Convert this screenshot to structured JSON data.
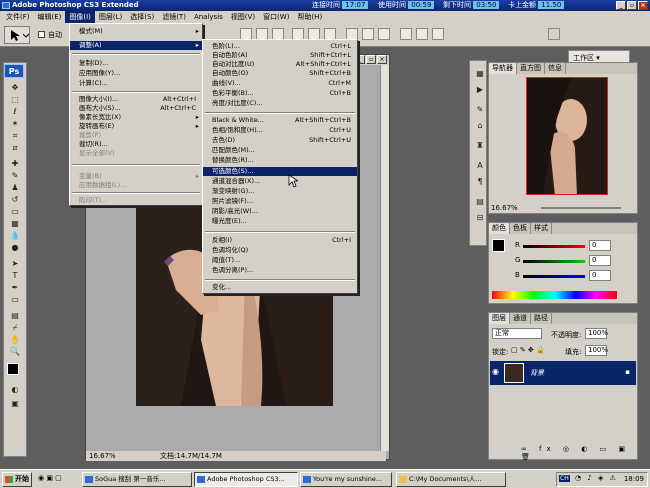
{
  "titlebar": {
    "title": "Adobe Photoshop CS3 Extended",
    "stats": [
      {
        "label": "连接时间",
        "value": "17:07"
      },
      {
        "label": "使用时间",
        "value": "00:59"
      },
      {
        "label": "剩下时间",
        "value": "03:50"
      },
      {
        "label": "卡上金额",
        "value": "11.50"
      }
    ]
  },
  "menubar": [
    "文件(F)",
    "编辑(E)",
    "图像(I)",
    "图层(L)",
    "选择(S)",
    "滤镜(T)",
    "Analysis",
    "视图(V)",
    "窗口(W)",
    "帮助(H)"
  ],
  "options": {
    "check_label": "自动",
    "workspace": "工作区"
  },
  "image_menu": [
    {
      "label": "模式(M)",
      "arrow": "▸"
    },
    {
      "label": "调整(A)",
      "arrow": "▸",
      "highlight": true
    },
    {
      "label": "复制(D)..."
    },
    {
      "label": "应用图像(Y)..."
    },
    {
      "label": "计算(C)..."
    },
    {
      "label": "图像大小(I)...",
      "shortcut": "Alt+Ctrl+I"
    },
    {
      "label": "画布大小(S)...",
      "shortcut": "Alt+Ctrl+C"
    },
    {
      "label": "像素长宽比(X)",
      "arrow": "▸"
    },
    {
      "label": "旋转画布(E)",
      "arrow": "▸"
    },
    {
      "label": "裁剪(P)",
      "disabled": true
    },
    {
      "label": "裁切(R)..."
    },
    {
      "label": "显示全部(V)",
      "disabled": true
    },
    {
      "label": "变量(B)",
      "arrow": "▸",
      "disabled": true
    },
    {
      "label": "应用数据组(L)...",
      "disabled": true
    },
    {
      "label": "陷印(T)...",
      "disabled": true
    }
  ],
  "adjust_menu": [
    {
      "label": "色阶(L)...",
      "shortcut": "Ctrl+L"
    },
    {
      "label": "自动色阶(A)",
      "shortcut": "Shift+Ctrl+L"
    },
    {
      "label": "自动对比度(U)",
      "shortcut": "Alt+Shift+Ctrl+L"
    },
    {
      "label": "自动颜色(O)",
      "shortcut": "Shift+Ctrl+B"
    },
    {
      "label": "曲线(V)...",
      "shortcut": "Ctrl+M"
    },
    {
      "label": "色彩平衡(B)...",
      "shortcut": "Ctrl+B"
    },
    {
      "label": "亮度/对比度(C)..."
    },
    {
      "label": "Black & White...",
      "shortcut": "Alt+Shift+Ctrl+B"
    },
    {
      "label": "色相/饱和度(H)...",
      "shortcut": "Ctrl+U"
    },
    {
      "label": "去色(D)",
      "shortcut": "Shift+Ctrl+U"
    },
    {
      "label": "匹配颜色(M)..."
    },
    {
      "label": "替换颜色(R)..."
    },
    {
      "label": "可选颜色(S)...",
      "highlight": true
    },
    {
      "label": "通道混合器(X)..."
    },
    {
      "label": "渐变映射(G)..."
    },
    {
      "label": "照片滤镜(F)..."
    },
    {
      "label": "阴影/高光(W)..."
    },
    {
      "label": "曝光度(E)..."
    },
    {
      "label": "反相(I)",
      "shortcut": "Ctrl+I"
    },
    {
      "label": "色调均化(Q)"
    },
    {
      "label": "阈值(T)..."
    },
    {
      "label": "色调分离(P)..."
    },
    {
      "label": "变化..."
    }
  ],
  "navigator": {
    "tabs": [
      "导航器",
      "直方图",
      "信息"
    ],
    "zoom": "16.67%"
  },
  "color_panel": {
    "tabs": [
      "颜色",
      "色板",
      "样式"
    ],
    "r": "0",
    "g": "0",
    "b": "0",
    "r_label": "R",
    "g_label": "G",
    "b_label": "B"
  },
  "layers_panel": {
    "tabs": [
      "图层",
      "通道",
      "路径"
    ],
    "blend_mode": "正常",
    "opacity_label": "不透明度:",
    "opacity": "100%",
    "lock_label": "锁定:",
    "fill_label": "填充:",
    "fill": "100%",
    "layer_name": "背景"
  },
  "document": {
    "zoom": "16.67%",
    "doc_info": "文档:14.7M/14.7M"
  },
  "taskbar": {
    "start": "开始",
    "tasks": [
      "SoGua 搜刮 第一音乐...",
      "Adobe Photoshop CS3...",
      "You're my sunshine...",
      "C:\\My Documents\\人..."
    ],
    "tray_text": "CH",
    "clock": "18:09"
  }
}
